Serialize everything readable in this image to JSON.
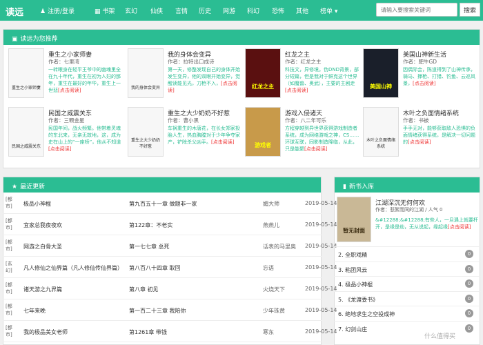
{
  "nav": {
    "brand": "读远",
    "login": "注册/登录",
    "shelf": "书架",
    "items": [
      "玄幻",
      "仙侠",
      "言情",
      "历史",
      "网游",
      "科幻",
      "恐怖",
      "其他",
      "榜单"
    ],
    "search_placeholder": "请输入要搜索关键词",
    "search_button": "搜索"
  },
  "recommend": {
    "title": "读远为您推荐",
    "books": [
      {
        "title": "重生之小家师妻",
        "author": "作者：七里湾",
        "desc": "一转眼身在轻平王爷中的幽魂里全在九十年代，重生在初为人妇的那年，重生在最好的年华，重生上一世悲",
        "more": "[点击阅读]",
        "cover": "重生之小家师妻"
      },
      {
        "title": "我的身体会变异",
        "author": "作者：拉特出口成诗",
        "desc": "第一天，修整发现自己的身体开始发生变异，他的双眼开始变异，觉醒读能见光，刀枪不入，",
        "more": "[点击阅读]",
        "cover": "我的身体会变异"
      },
      {
        "title": "红龙之主",
        "author": "作者：红龙之主",
        "desc": "科技文，异修境。伪DND背景，部分短篇，但是我对于鲜克这个世界（如魔兽、奥武），主要的主剧走",
        "more": "[点击阅读]",
        "cover": "红龙之主"
      },
      {
        "title": "美国山神新生活",
        "author": "作者：肥牛GD",
        "desc": "因偶际会，陈道得到了山神传承，骑马、撑枪、打猎、钓鱼、云巡风景，",
        "more": "[点击阅读]",
        "cover": "美国山神"
      },
      {
        "title": "民国之威震关东",
        "author": "作者：三颗金星",
        "desc": "民国年间，战火频繁。他带着灵魂的东北来，无亲无故地，这，成为史在山上的“一座桥”，他从不知道",
        "more": "[点击阅读]",
        "cover": "民国之威震关东"
      },
      {
        "title": "重生之大少奶奶不好惹",
        "author": "作者：曹小黑",
        "desc": "车祸重生的木唐花，在长女郑家投胎人生，热血胸膛对于少年争夺家产，铲除杀父凶手。",
        "more": "[点击阅读]",
        "cover": "重生之大少奶奶不好惹"
      },
      {
        "title": "游戏入侵诸天",
        "author": "作者：八二年可乐",
        "desc": "方程穿越到异世界获得游戏制造者系统，成为网络游戏之神，CS……环球互联，同影制造降临，从此，只是能聚",
        "more": "[点击阅读]",
        "cover": "游戏者"
      },
      {
        "title": "木叶之负面情绪系统",
        "author": "作者：书被",
        "desc": "手手无对，能够获取敌人恐惧的负面情绪获得系统，是解决一切问题的",
        "more": "[点击阅读]",
        "cover": "木叶之负面情绪系统"
      }
    ]
  },
  "latest": {
    "title": "最近更新",
    "rows": [
      {
        "cat": "[都市]",
        "title": "极品小神棍",
        "chapter": "第九百五十一章 做题非一家",
        "author": "媚大师",
        "date": "2019-05-14"
      },
      {
        "cat": "[都市]",
        "title": "宜家总我夜夜欢",
        "chapter": "第122章：不老实",
        "author": "燕燕儿",
        "date": "2019-05-14"
      },
      {
        "cat": "[都市]",
        "title": "网游之白骨大圣",
        "chapter": "第一七七章 总死",
        "author": "话表的马里奥",
        "date": "2019-05-14"
      },
      {
        "cat": "[玄幻]",
        "title": "凡人修仙之仙界篇（凡人修仙传仙界篇）",
        "chapter": "第八百八十四章 取回",
        "author": "忘语",
        "date": "2019-05-14"
      },
      {
        "cat": "[都市]",
        "title": "诸天游之九界篇",
        "chapter": "第八章 初见",
        "author": "火烧天下",
        "date": "2019-05-14"
      },
      {
        "cat": "[都市]",
        "title": "七年来晚",
        "chapter": "第一百二十三章 我陪你",
        "author": "少年珠黄",
        "date": "2019-05-14"
      },
      {
        "cat": "[都市]",
        "title": "我的极品美女老师",
        "chapter": "第1261章 带钱",
        "author": "寒东",
        "date": "2019-05-14"
      }
    ]
  },
  "newbooks": {
    "title": "新书入库",
    "featured": {
      "title": "江湖深沉无何何欢",
      "author": "作者：悲絮而同的江湖 / 人气 0",
      "desc": "&#12288;&#12288;有些人，一旦遇上就要杆开，是缘是劫，无从说起，缘起缘",
      "more": "[点击阅读]",
      "cover": "暂无封面"
    },
    "items": [
      {
        "name": "2. 全职戏精",
        "count": "0"
      },
      {
        "name": "3. 粘团风云",
        "count": "0"
      },
      {
        "name": "4. 极品小神棍",
        "count": "0"
      },
      {
        "name": "5. 《龙渡委书》",
        "count": "0"
      },
      {
        "name": "6. 绝地求生之空投成神",
        "count": "0"
      },
      {
        "name": "7. 幻剑山庄",
        "count": "0"
      }
    ]
  },
  "watermark": "什么值得买"
}
